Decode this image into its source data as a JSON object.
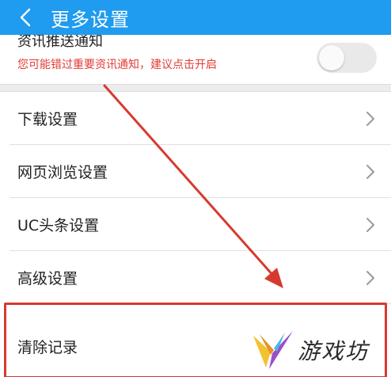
{
  "header": {
    "title": "更多设置",
    "back_icon": "chevron-left-icon"
  },
  "notify_row": {
    "title": "资讯推送通知",
    "description": "您可能错过重要资讯通知，建议点击开启",
    "toggle_on": false
  },
  "menu": {
    "items": [
      {
        "label": "下载设置"
      },
      {
        "label": "网页浏览设置"
      },
      {
        "label": "UC头条设置"
      },
      {
        "label": "高级设置"
      }
    ],
    "clear_label": "清除记录"
  },
  "annotation": {
    "color": "#d63a2f"
  },
  "watermark": {
    "text": "游戏坊"
  },
  "colors": {
    "header_bg": "#1f9bef",
    "warning_text": "#e23b34"
  }
}
